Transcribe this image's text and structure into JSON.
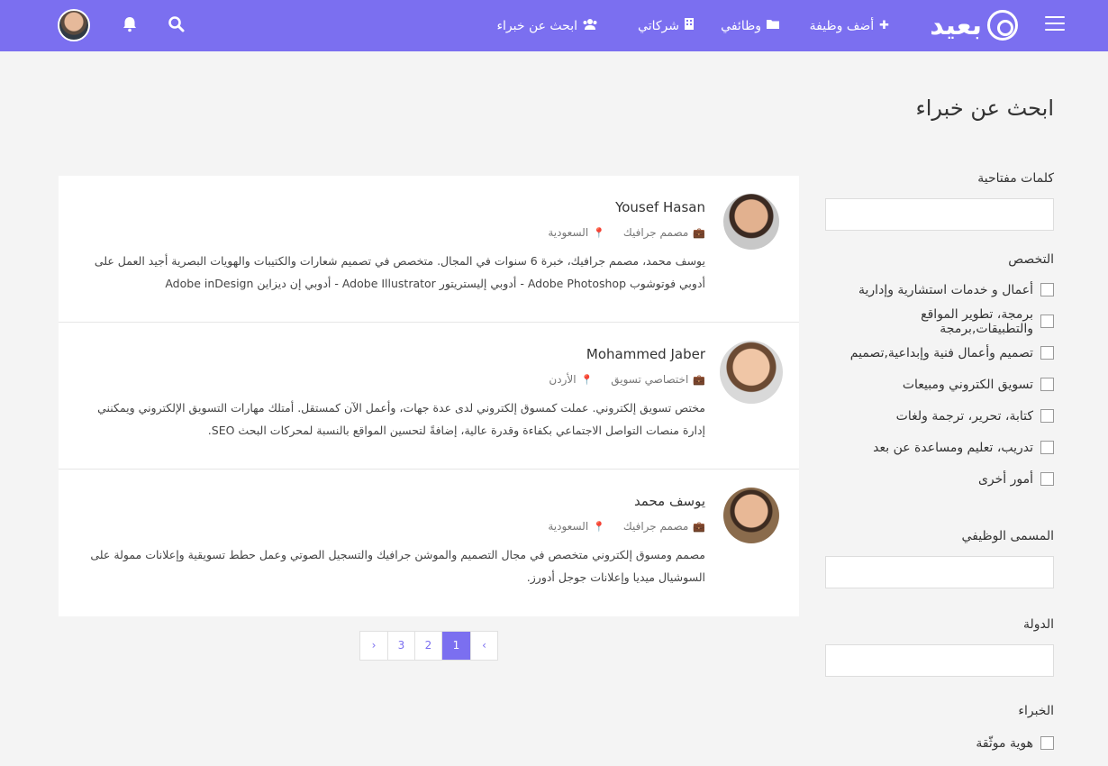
{
  "header": {
    "logo_text": "بعيد",
    "nav": {
      "add_job": "أضف وظيفة",
      "my_jobs": "وظائفي",
      "my_companies": "شركاتي",
      "find_experts": "ابحث عن خبراء"
    }
  },
  "page": {
    "title": "ابحث عن خبراء"
  },
  "sidebar": {
    "keywords_label": "كلمات مفتاحية",
    "specialty_label": "التخصص",
    "specialties": [
      "أعمال و خدمات استشارية وإدارية",
      "برمجة، تطوير المواقع والتطبيقات,برمجة",
      "تصميم وأعمال فنية وإبداعية,تصميم",
      "تسويق الكتروني ومبيعات",
      "كتابة، تحرير، ترجمة ولغات",
      "تدريب، تعليم ومساعدة عن بعد",
      "أمور أخرى"
    ],
    "job_title_label": "المسمى الوظيفي",
    "country_label": "الدولة",
    "experts_label": "الخبراء",
    "verified_label": "هوية موثّقة"
  },
  "experts": [
    {
      "name": "Yousef Hasan",
      "role": "مصمم جرافيك",
      "country": "السعودية",
      "desc": "يوسف محمد، مصمم جرافيك، خبرة 6 سنوات في المجال. متخصص في تصميم شعارات والكتيبات والهويات البصرية أجيد العمل على أدوبي فوتوشوب Adobe Photoshop - أدوبي إليستريتور Adobe Illustrator - أدوبي إن ديزاين Adobe inDesign"
    },
    {
      "name": "Mohammed Jaber",
      "role": "اختصاصي تسويق",
      "country": "الأردن",
      "desc": "مختص تسويق إلكتروني. عملت كمسوق إلكتروني لدى عدة جهات، وأعمل الآن كمستقل. أمتلك مهارات التسويق الإلكتروني ويمكنني إدارة منصات التواصل الاجتماعي بكفاءة وقدرة عالية، إضافةً لتحسين المواقع بالنسبة لمحركات البحث SEO."
    },
    {
      "name": "يوسف محمد",
      "role": "مصمم جرافيك",
      "country": "السعودية",
      "desc": "مصمم ومسوق إلكتروني متخصص في مجال التصميم والموشن جرافيك والتسجيل الصوتي وعمل حطط تسويقية وإعلانات ممولة على السوشيال ميديا وإعلانات جوجل أدورز."
    }
  ],
  "pagination": {
    "prev": "‹",
    "pages": [
      "1",
      "2",
      "3"
    ],
    "next": "›",
    "active": "1"
  }
}
